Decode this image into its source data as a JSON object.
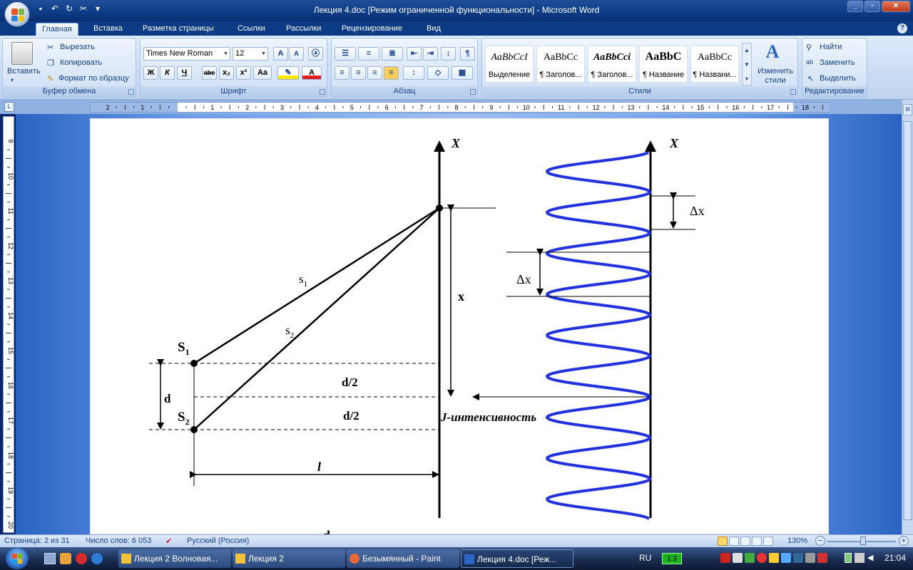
{
  "window": {
    "title": "Лекция 4.doc [Режим ограниченной функциональности] - Microsoft Word",
    "controls": {
      "minimize": "_",
      "maximize": "▫",
      "close": "✕"
    }
  },
  "ribbon_tabs": [
    "Главная",
    "Вставка",
    "Разметка страницы",
    "Ссылки",
    "Рассылки",
    "Рецензирование",
    "Вид"
  ],
  "clipboard": {
    "paste": "Вставить",
    "cut": "Вырезать",
    "copy": "Копировать",
    "format_painter": "Формат по образцу",
    "title": "Буфер обмена"
  },
  "font": {
    "name": "Times New Roman",
    "size": "12",
    "grow": "A",
    "shrink": "A",
    "bold": "Ж",
    "italic": "К",
    "underline": "Ч",
    "strike": "abe",
    "subscript": "x₂",
    "superscript": "x²",
    "change_case": "Aa",
    "title": "Шрифт"
  },
  "paragraph": {
    "title": "Абзац"
  },
  "styles": {
    "items": [
      {
        "preview": "AaBbCcI",
        "name": "Выделение"
      },
      {
        "preview": "AaBbCc",
        "name": "¶ Заголов..."
      },
      {
        "preview": "AaBbCci",
        "name": "¶ Заголов..."
      },
      {
        "preview": "AaBbC",
        "name": "¶ Название"
      },
      {
        "preview": "AaBbCc",
        "name": "¶ Названи..."
      }
    ],
    "change_styles": "Изменить стили",
    "title": "Стили"
  },
  "editing": {
    "find": "Найти",
    "replace": "Заменить",
    "select": "Выделить",
    "title": "Редактирование"
  },
  "ruler": {
    "h_labels": [
      "2",
      "1",
      "",
      "1",
      "2",
      "3",
      "4",
      "5",
      "6",
      "7",
      "8",
      "9",
      "10",
      "11",
      "12",
      "13",
      "14",
      "15",
      "16",
      "17",
      "18"
    ],
    "v_labels": [
      "9",
      "10",
      "11",
      "12",
      "13",
      "14",
      "15",
      "16",
      "17",
      "18",
      "19",
      "20"
    ]
  },
  "diagram": {
    "axis_x": "X",
    "axis_x2": "X",
    "s1_label": "S",
    "s1_sub": "1",
    "s2_label": "S",
    "s2_sub": "2",
    "ray1_label": "s",
    "ray1_sub": "1",
    "ray2_label": "s",
    "ray2_sub": "2",
    "x_label": "x",
    "d_label": "d",
    "half_d_top": "d/2",
    "half_d_bottom": "d/2",
    "l_label": "l",
    "intensity_label": "J-интенсивность",
    "dx_label_right": "Δx",
    "dx_label_left": "Δx",
    "bottom_text": "d"
  },
  "status": {
    "page": "Страница: 2 из 31",
    "words": "Число слов: 6 053",
    "language": "Русский (Россия)",
    "zoom": "130%"
  },
  "taskbar": {
    "buttons": [
      "Лекция 2 Волновая...",
      "Лекция 2",
      "Безымянный - Paint",
      "Лекция 4.doc [Реж..."
    ],
    "lang": "RU",
    "clock": "21:04",
    "battery_indicator": "1:3"
  },
  "colors": {
    "wave": "#2233dd",
    "title_bar": "#0c3b86",
    "ribbon": "#c7daf3"
  }
}
